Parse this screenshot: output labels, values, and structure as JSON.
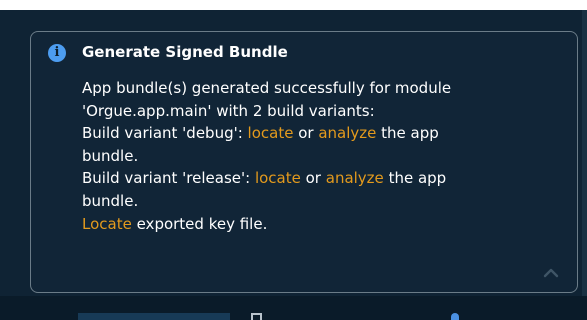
{
  "notification": {
    "icon": "info-icon",
    "title": "Generate Signed Bundle",
    "line1": "App bundle(s) generated successfully for module",
    "line2": "'Orgue.app.main' with 2 build variants:",
    "debug": {
      "prefix": "Build variant 'debug': ",
      "locate_link": "locate",
      "or": " or ",
      "analyze_link": "analyze",
      "suffix": " the app",
      "wrap": "bundle."
    },
    "release": {
      "prefix": "Build variant 'release': ",
      "locate_link": "locate",
      "or": " or ",
      "analyze_link": "analyze",
      "suffix": " the app",
      "wrap": "bundle."
    },
    "key_file": {
      "link": "Locate",
      "text": " exported key file."
    },
    "collapse_icon": "chevron-up-icon"
  },
  "colors": {
    "background": "#0f2334",
    "panel": "#112537",
    "link": "#e39a1d",
    "info": "#4d9df0",
    "text": "#ffffff"
  }
}
